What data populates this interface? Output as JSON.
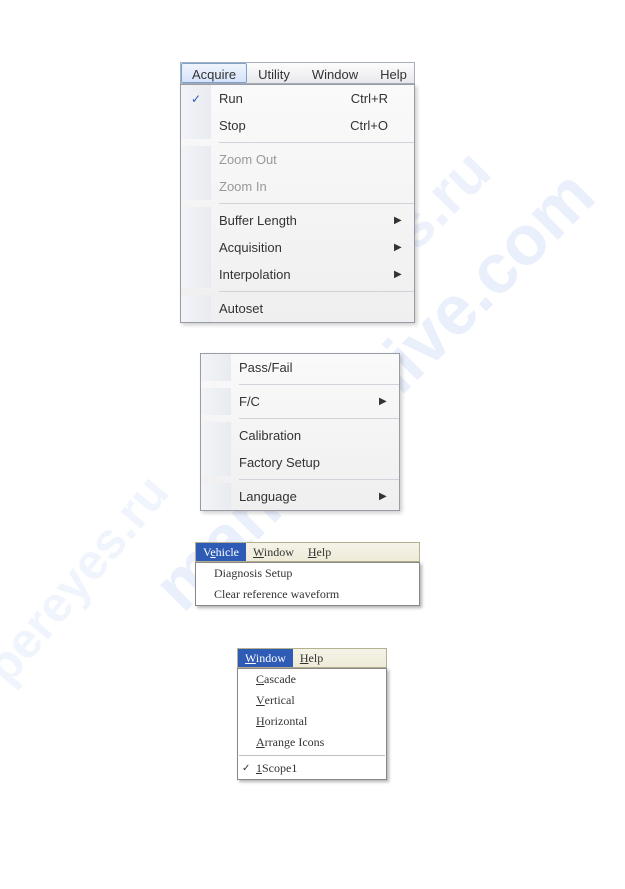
{
  "watermarks": {
    "main": "manualshive.com",
    "side1": "eyes.ru",
    "side2": "pereyes.ru"
  },
  "menu1": {
    "menubar": [
      {
        "label": "Acquire",
        "active": true
      },
      {
        "label": "Utility",
        "active": false
      },
      {
        "label": "Window",
        "active": false
      },
      {
        "label": "Help",
        "active": false
      }
    ],
    "items": [
      {
        "label": "Run",
        "shortcut": "Ctrl+R",
        "checked": true,
        "submenu": false,
        "disabled": false
      },
      {
        "label": "Stop",
        "shortcut": "Ctrl+O",
        "checked": false,
        "submenu": false,
        "disabled": false
      },
      {
        "sep": true
      },
      {
        "label": "Zoom Out",
        "shortcut": "",
        "checked": false,
        "submenu": false,
        "disabled": true
      },
      {
        "label": "Zoom In",
        "shortcut": "",
        "checked": false,
        "submenu": false,
        "disabled": true
      },
      {
        "sep": true
      },
      {
        "label": "Buffer Length",
        "shortcut": "",
        "checked": false,
        "submenu": true,
        "disabled": false
      },
      {
        "label": "Acquisition",
        "shortcut": "",
        "checked": false,
        "submenu": true,
        "disabled": false
      },
      {
        "label": "Interpolation",
        "shortcut": "",
        "checked": false,
        "submenu": true,
        "disabled": false
      },
      {
        "sep": true
      },
      {
        "label": "Autoset",
        "shortcut": "",
        "checked": false,
        "submenu": false,
        "disabled": false
      }
    ]
  },
  "menu2": {
    "items": [
      {
        "label": "Pass/Fail",
        "submenu": false
      },
      {
        "sep": true
      },
      {
        "label": "F/C",
        "submenu": true
      },
      {
        "sep": true
      },
      {
        "label": "Calibration",
        "submenu": false
      },
      {
        "label": "Factory Setup",
        "submenu": false
      },
      {
        "sep": true
      },
      {
        "label": "Language",
        "submenu": true
      }
    ]
  },
  "menu3": {
    "menubar": [
      {
        "pre": "V",
        "ul": "e",
        "post": "hicle",
        "active": true
      },
      {
        "pre": "",
        "ul": "W",
        "post": "indow",
        "active": false
      },
      {
        "pre": "",
        "ul": "H",
        "post": "elp",
        "active": false
      }
    ],
    "items": [
      {
        "label": "Diagnosis Setup"
      },
      {
        "label": "Clear reference waveform"
      }
    ]
  },
  "menu4": {
    "menubar": [
      {
        "pre": "",
        "ul": "W",
        "post": "indow",
        "active": true
      },
      {
        "pre": "",
        "ul": "H",
        "post": "elp",
        "active": false
      }
    ],
    "items": [
      {
        "pre": "",
        "ul": "C",
        "post": "ascade",
        "checked": false
      },
      {
        "pre": "",
        "ul": "V",
        "post": "ertical",
        "checked": false
      },
      {
        "pre": "",
        "ul": "H",
        "post": "orizontal",
        "checked": false
      },
      {
        "pre": "",
        "ul": "A",
        "post": "rrange Icons",
        "checked": false
      },
      {
        "sep": true
      },
      {
        "pre": "",
        "ul": "1",
        "post": " Scope1",
        "checked": true
      }
    ]
  }
}
